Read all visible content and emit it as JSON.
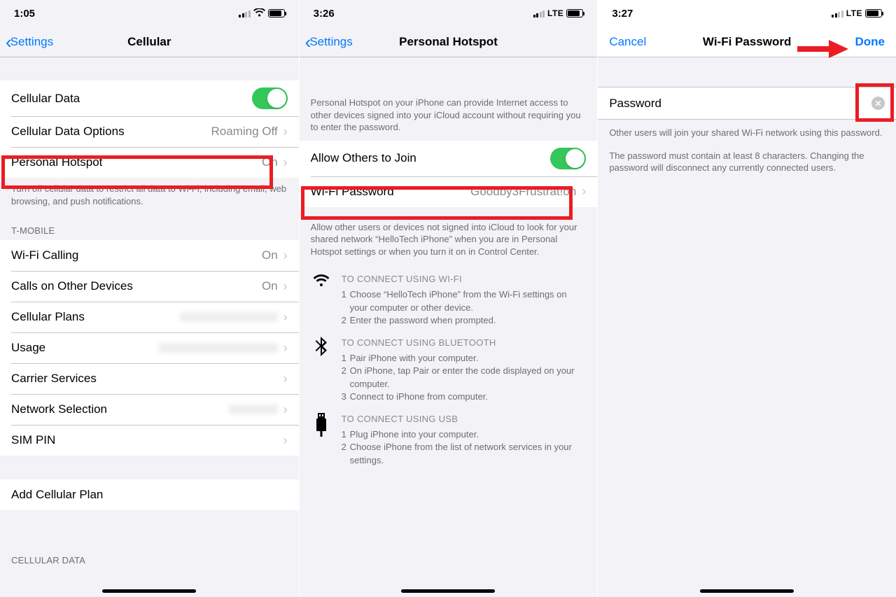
{
  "phone1": {
    "status": {
      "time": "1:05",
      "network": "wifi"
    },
    "nav": {
      "back": "Settings",
      "title": "Cellular"
    },
    "rows": {
      "cellular_data": "Cellular Data",
      "cellular_data_options": {
        "label": "Cellular Data Options",
        "value": "Roaming Off"
      },
      "personal_hotspot": {
        "label": "Personal Hotspot",
        "value": "On"
      }
    },
    "footer1": "Turn off cellular data to restrict all data to Wi-Fi, including email, web browsing, and push notifications.",
    "section2_header": "T-MOBILE",
    "rows2": {
      "wifi_calling": {
        "label": "Wi-Fi Calling",
        "value": "On"
      },
      "calls_other": {
        "label": "Calls on Other Devices",
        "value": "On"
      },
      "cellular_plans": {
        "label": "Cellular Plans",
        "value": ""
      },
      "usage": {
        "label": "Usage",
        "value": ""
      },
      "carrier_services": {
        "label": "Carrier Services",
        "value": ""
      },
      "network_selection": {
        "label": "Network Selection",
        "value": ""
      },
      "sim_pin": {
        "label": "SIM PIN",
        "value": ""
      }
    },
    "add_plan": "Add Cellular Plan",
    "section4_header": "CELLULAR DATA"
  },
  "phone2": {
    "status": {
      "time": "3:26",
      "network": "LTE"
    },
    "nav": {
      "back": "Settings",
      "title": "Personal Hotspot"
    },
    "intro": "Personal Hotspot on your iPhone can provide Internet access to other devices signed into your iCloud account without requiring you to enter the password.",
    "rows": {
      "allow_others": "Allow Others to Join",
      "wifi_password": {
        "label": "Wi-Fi Password",
        "value": "Goodby3Frustrat!on"
      }
    },
    "note": "Allow other users or devices not signed into iCloud to look for your shared network “HelloTech iPhone” when you are in Personal Hotspot settings or when you turn it on in Control Center.",
    "instructions": {
      "wifi": {
        "title": "TO CONNECT USING WI-FI",
        "steps": [
          "Choose “HelloTech iPhone” from the Wi-Fi settings on your computer or other device.",
          "Enter the password when prompted."
        ]
      },
      "bluetooth": {
        "title": "TO CONNECT USING BLUETOOTH",
        "steps": [
          "Pair iPhone with your computer.",
          "On iPhone, tap Pair or enter the code displayed on your computer.",
          "Connect to iPhone from computer."
        ]
      },
      "usb": {
        "title": "TO CONNECT USING USB",
        "steps": [
          "Plug iPhone into your computer.",
          "Choose iPhone from the list of network services in your settings."
        ]
      }
    }
  },
  "phone3": {
    "status": {
      "time": "3:27",
      "network": "LTE"
    },
    "nav": {
      "left": "Cancel",
      "title": "Wi-Fi Password",
      "right": "Done"
    },
    "password_label": "Password",
    "footer1": "Other users will join your shared Wi-Fi network using this password.",
    "footer2": "The password must contain at least 8 characters. Changing the password will disconnect any currently connected users."
  }
}
